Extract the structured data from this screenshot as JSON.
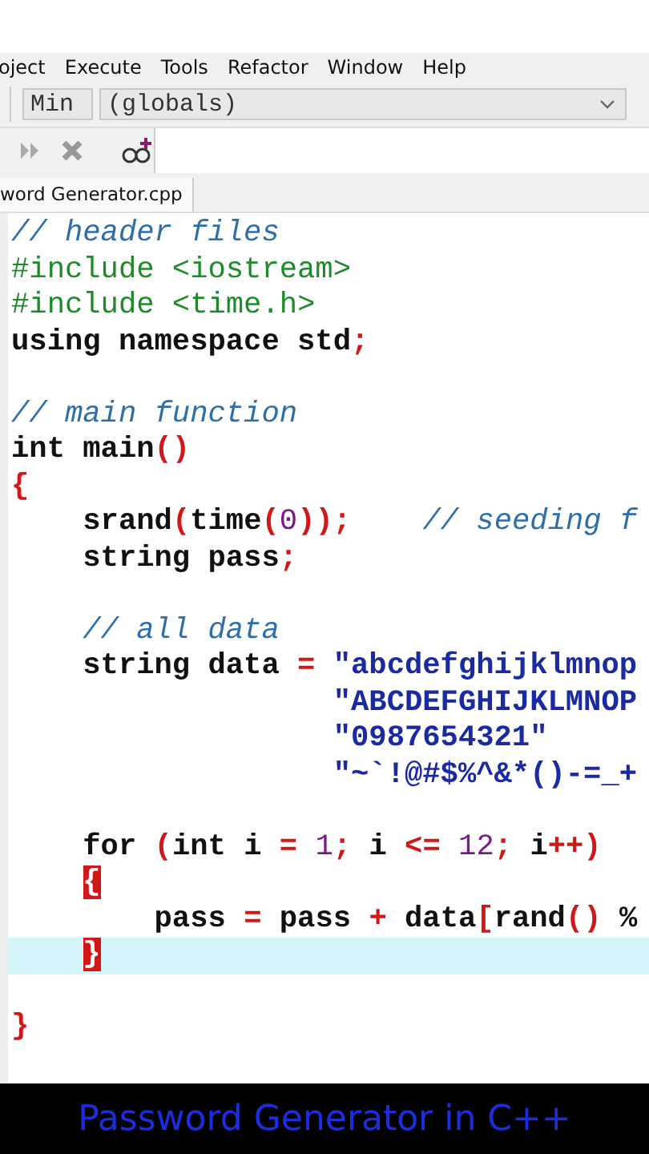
{
  "menu": [
    "oject",
    "Execute",
    "Tools",
    "Refactor",
    "Window",
    "Help"
  ],
  "toolbar": {
    "scope": "Min",
    "symbol": "(globals)"
  },
  "tabs": [
    {
      "label": "word Generator.cpp",
      "selected": true
    }
  ],
  "code_lines": [
    {
      "selected": false,
      "tokens": [
        {
          "kind": "comment",
          "text": "// header files"
        }
      ]
    },
    {
      "selected": false,
      "tokens": [
        {
          "kind": "preproc",
          "text": "#include <iostream>"
        }
      ]
    },
    {
      "selected": false,
      "tokens": [
        {
          "kind": "preproc",
          "text": "#include <time.h>"
        }
      ]
    },
    {
      "selected": false,
      "tokens": [
        {
          "kind": "plain",
          "text": "using namespace std"
        },
        {
          "kind": "punct",
          "text": ";"
        }
      ]
    },
    {
      "selected": false
    },
    {
      "selected": false,
      "tokens": [
        {
          "kind": "comment",
          "text": "// main function"
        }
      ]
    },
    {
      "selected": false,
      "tokens": [
        {
          "kind": "plain",
          "text": "int main"
        },
        {
          "kind": "punct",
          "text": "()"
        }
      ]
    },
    {
      "selected": false,
      "tokens": [
        {
          "kind": "punct",
          "text": "{"
        }
      ]
    },
    {
      "selected": false,
      "tokens": [
        {
          "kind": "plain",
          "text": "    srand"
        },
        {
          "kind": "punct",
          "text": "("
        },
        {
          "kind": "plain",
          "text": "time"
        },
        {
          "kind": "punct",
          "text": "("
        },
        {
          "kind": "number",
          "text": "0"
        },
        {
          "kind": "punct",
          "text": "));"
        },
        {
          "kind": "comment",
          "text": "    // seeding f"
        }
      ]
    },
    {
      "selected": false,
      "tokens": [
        {
          "kind": "plain",
          "text": "    string pass"
        },
        {
          "kind": "punct",
          "text": ";"
        }
      ]
    },
    {
      "selected": false
    },
    {
      "selected": false,
      "tokens": [
        {
          "kind": "comment",
          "text": "    // all data"
        }
      ]
    },
    {
      "selected": false,
      "tokens": [
        {
          "kind": "plain",
          "text": "    string data "
        },
        {
          "kind": "punct",
          "text": "="
        },
        {
          "kind": "string",
          "text": " \"abcdefghijklmnop"
        }
      ]
    },
    {
      "selected": false,
      "tokens": [
        {
          "kind": "string",
          "text": "                  \"ABCDEFGHIJKLMNOP"
        }
      ]
    },
    {
      "selected": false,
      "tokens": [
        {
          "kind": "string",
          "text": "                  \"0987654321\""
        }
      ]
    },
    {
      "selected": false,
      "tokens": [
        {
          "kind": "string",
          "text": "                  \"~`!@#$%^&*()-=_+"
        }
      ]
    },
    {
      "selected": false
    },
    {
      "selected": false,
      "tokens": [
        {
          "kind": "plain",
          "text": "    for "
        },
        {
          "kind": "punct",
          "text": "("
        },
        {
          "kind": "plain",
          "text": "int i "
        },
        {
          "kind": "punct",
          "text": "="
        },
        {
          "kind": "number",
          "text": " 1"
        },
        {
          "kind": "punct",
          "text": ";"
        },
        {
          "kind": "plain",
          "text": " i "
        },
        {
          "kind": "punct",
          "text": "<="
        },
        {
          "kind": "number",
          "text": " 12"
        },
        {
          "kind": "punct",
          "text": ";"
        },
        {
          "kind": "plain",
          "text": " i"
        },
        {
          "kind": "punct",
          "text": "++)"
        }
      ]
    },
    {
      "selected": false,
      "tokens": [
        {
          "kind": "brace",
          "text": "    {"
        }
      ]
    },
    {
      "selected": false,
      "tokens": [
        {
          "kind": "plain",
          "text": "        pass "
        },
        {
          "kind": "punct",
          "text": "="
        },
        {
          "kind": "plain",
          "text": " pass "
        },
        {
          "kind": "punct",
          "text": "+"
        },
        {
          "kind": "plain",
          "text": " data"
        },
        {
          "kind": "punct",
          "text": "["
        },
        {
          "kind": "plain",
          "text": "rand"
        },
        {
          "kind": "punct",
          "text": "()"
        },
        {
          "kind": "plain",
          "text": " %"
        }
      ]
    },
    {
      "selected": true,
      "tokens": [
        {
          "kind": "brace",
          "text": "    }"
        }
      ]
    },
    {
      "selected": false
    },
    {
      "selected": false,
      "tokens": [
        {
          "kind": "punct",
          "text": "}"
        }
      ]
    }
  ],
  "caption": "Password Generator in C++"
}
